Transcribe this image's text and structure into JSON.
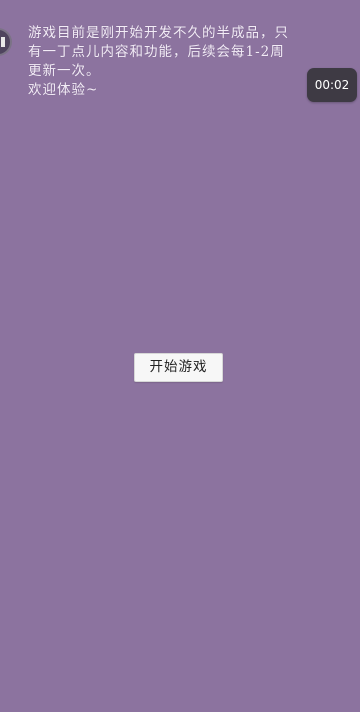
{
  "intro": {
    "lines": [
      "游戏目前是刚开始开发不久的半成品，只",
      "有一丁点儿内容和功能，后续会每1-2周",
      "更新一次。",
      "欢迎体验~"
    ]
  },
  "timer": {
    "value": "00:02"
  },
  "start_button": {
    "label": "开始游戏"
  },
  "colors": {
    "background": "#8c739f",
    "timer_bg": "#3e3a44",
    "button_bg": "#f7f7f7"
  },
  "icons": {
    "float_handle": "menu-handle-icon"
  }
}
